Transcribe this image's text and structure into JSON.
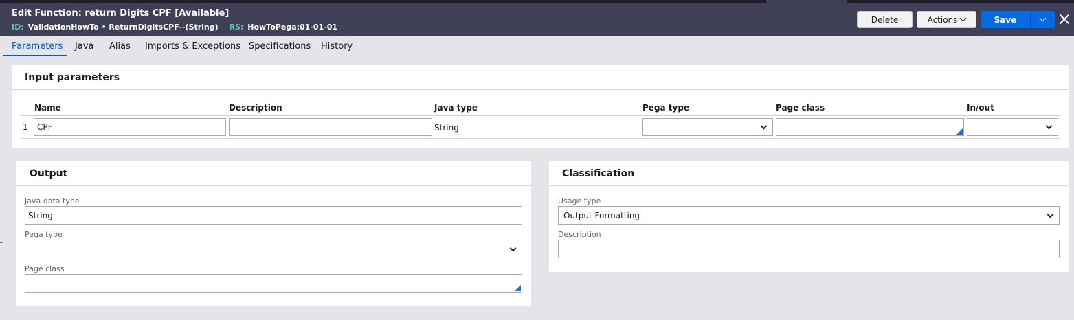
{
  "header": {
    "title_prefix": "Edit  Function: return Digits CPF",
    "status": "[Available]",
    "id_label": "ID:",
    "id_value": "ValidationHowTo • ReturnDigitsCPF--(String)",
    "rs_label": "RS:",
    "rs_value": "HowToPega:01-01-01",
    "delete_label": "Delete",
    "actions_label": "Actions",
    "save_label": "Save"
  },
  "tabs": [
    {
      "label": "Parameters",
      "active": true
    },
    {
      "label": "Java"
    },
    {
      "label": "Alias"
    },
    {
      "label": "Imports & Exceptions"
    },
    {
      "label": "Specifications"
    },
    {
      "label": "History"
    }
  ],
  "input_parameters": {
    "title": "Input parameters",
    "columns": [
      "Name",
      "Description",
      "Java type",
      "Pega type",
      "Page class",
      "In/out"
    ],
    "rows": [
      {
        "num": "1",
        "name": "CPF",
        "description": "",
        "java_type": "String",
        "pega_type": "",
        "page_class": "",
        "in_out": ""
      }
    ]
  },
  "output": {
    "title": "Output",
    "java_data_type_label": "Java data type",
    "java_data_type_value": "String",
    "pega_type_label": "Pega type",
    "pega_type_value": "",
    "page_class_label": "Page class",
    "page_class_value": ""
  },
  "classification": {
    "title": "Classification",
    "usage_type_label": "Usage type",
    "usage_type_value": "Output Formatting",
    "description_label": "Description",
    "description_value": ""
  },
  "colors": {
    "header_bg": "#3f3f55",
    "accent_teal": "#4ec9c2",
    "primary_blue": "#076bdf",
    "tab_active": "#0a58c8"
  }
}
